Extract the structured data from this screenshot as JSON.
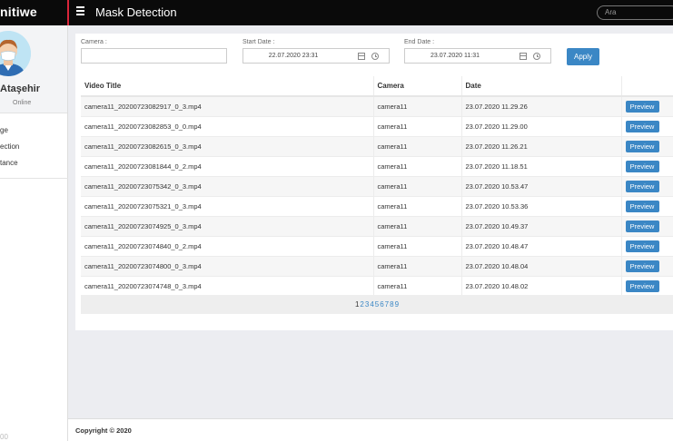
{
  "app": {
    "brand": "nitiwe",
    "page_title": "Mask Detection"
  },
  "search": {
    "placeholder": "Ara"
  },
  "user": {
    "name": "Ataşehir",
    "status": "Online"
  },
  "sidebar": {
    "items": [
      {
        "label": "ge"
      },
      {
        "label": "ection"
      },
      {
        "label": "tance"
      }
    ],
    "footer": "00"
  },
  "filters": {
    "camera_label": "Camera :",
    "camera_value": "",
    "start_label": "Start Date :",
    "start_value": "22.07.2020 23:31",
    "end_label": "End Date :",
    "end_value": "23.07.2020 11:31",
    "apply_label": "Apply"
  },
  "table": {
    "headers": [
      "Video Title",
      "Camera",
      "Date",
      ""
    ],
    "preview_label": "Preview",
    "rows": [
      {
        "title": "camera11_20200723082917_0_3.mp4",
        "camera": "camera11",
        "date": "23.07.2020 11.29.26"
      },
      {
        "title": "camera11_20200723082853_0_0.mp4",
        "camera": "camera11",
        "date": "23.07.2020 11.29.00"
      },
      {
        "title": "camera11_20200723082615_0_3.mp4",
        "camera": "camera11",
        "date": "23.07.2020 11.26.21"
      },
      {
        "title": "camera11_20200723081844_0_2.mp4",
        "camera": "camera11",
        "date": "23.07.2020 11.18.51"
      },
      {
        "title": "camera11_20200723075342_0_3.mp4",
        "camera": "camera11",
        "date": "23.07.2020 10.53.47"
      },
      {
        "title": "camera11_20200723075321_0_3.mp4",
        "camera": "camera11",
        "date": "23.07.2020 10.53.36"
      },
      {
        "title": "camera11_20200723074925_0_3.mp4",
        "camera": "camera11",
        "date": "23.07.2020 10.49.37"
      },
      {
        "title": "camera11_20200723074840_0_2.mp4",
        "camera": "camera11",
        "date": "23.07.2020 10.48.47"
      },
      {
        "title": "camera11_20200723074800_0_3.mp4",
        "camera": "camera11",
        "date": "23.07.2020 10.48.04"
      },
      {
        "title": "camera11_20200723074748_0_3.mp4",
        "camera": "camera11",
        "date": "23.07.2020 10.48.02"
      }
    ]
  },
  "pagination": {
    "pages": [
      "1",
      "2",
      "3",
      "4",
      "5",
      "6",
      "7",
      "8",
      "9"
    ],
    "current": "1"
  },
  "footer": {
    "copyright": "Copyright © 2020"
  },
  "colors": {
    "accent": "#3b87c5",
    "brand_red": "#d9263a",
    "topbar": "#0a0a0a"
  }
}
